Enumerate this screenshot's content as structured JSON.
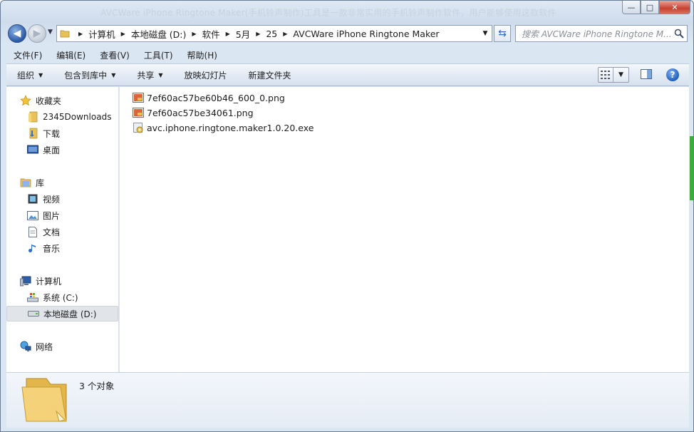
{
  "window": {
    "title": "AVCWare iPhone Ringtone Maker(手机铃声制作)工具是一款非常实用的手机铃声制作软件，用户能够使用这款软件",
    "min_label": "—",
    "max_label": "□",
    "close_label": "✕"
  },
  "address": {
    "crumbs": [
      "计算机",
      "本地磁盘 (D:)",
      "软件",
      "5月",
      "25",
      "AVCWare iPhone Ringtone Maker"
    ],
    "search_placeholder": "搜索 AVCWare iPhone Ringtone M..."
  },
  "menu": {
    "items": [
      "文件(F)",
      "编辑(E)",
      "查看(V)",
      "工具(T)",
      "帮助(H)"
    ]
  },
  "commands": {
    "organize": "组织",
    "include_library": "包含到库中",
    "share": "共享",
    "slideshow": "放映幻灯片",
    "new_folder": "新建文件夹"
  },
  "nav": {
    "favorites": "收藏夹",
    "fav_items": [
      "2345Downloads",
      "下载",
      "桌面"
    ],
    "libraries": "库",
    "lib_items": [
      "视频",
      "图片",
      "文档",
      "音乐"
    ],
    "computer": "计算机",
    "drives": [
      "系统 (C:)",
      "本地磁盘 (D:)"
    ],
    "network": "网络"
  },
  "files": [
    {
      "name": "7ef60ac57be60b46_600_0.png",
      "type": "png"
    },
    {
      "name": "7ef60ac57be34061.png",
      "type": "png"
    },
    {
      "name": "avc.iphone.ringtone.maker1.0.20.exe",
      "type": "exe"
    }
  ],
  "details": {
    "count_text": "3 个对象"
  },
  "colors": {
    "accent": "#2c5aa8",
    "selection": "#e1e4e9",
    "folder": "#e9c45a"
  }
}
